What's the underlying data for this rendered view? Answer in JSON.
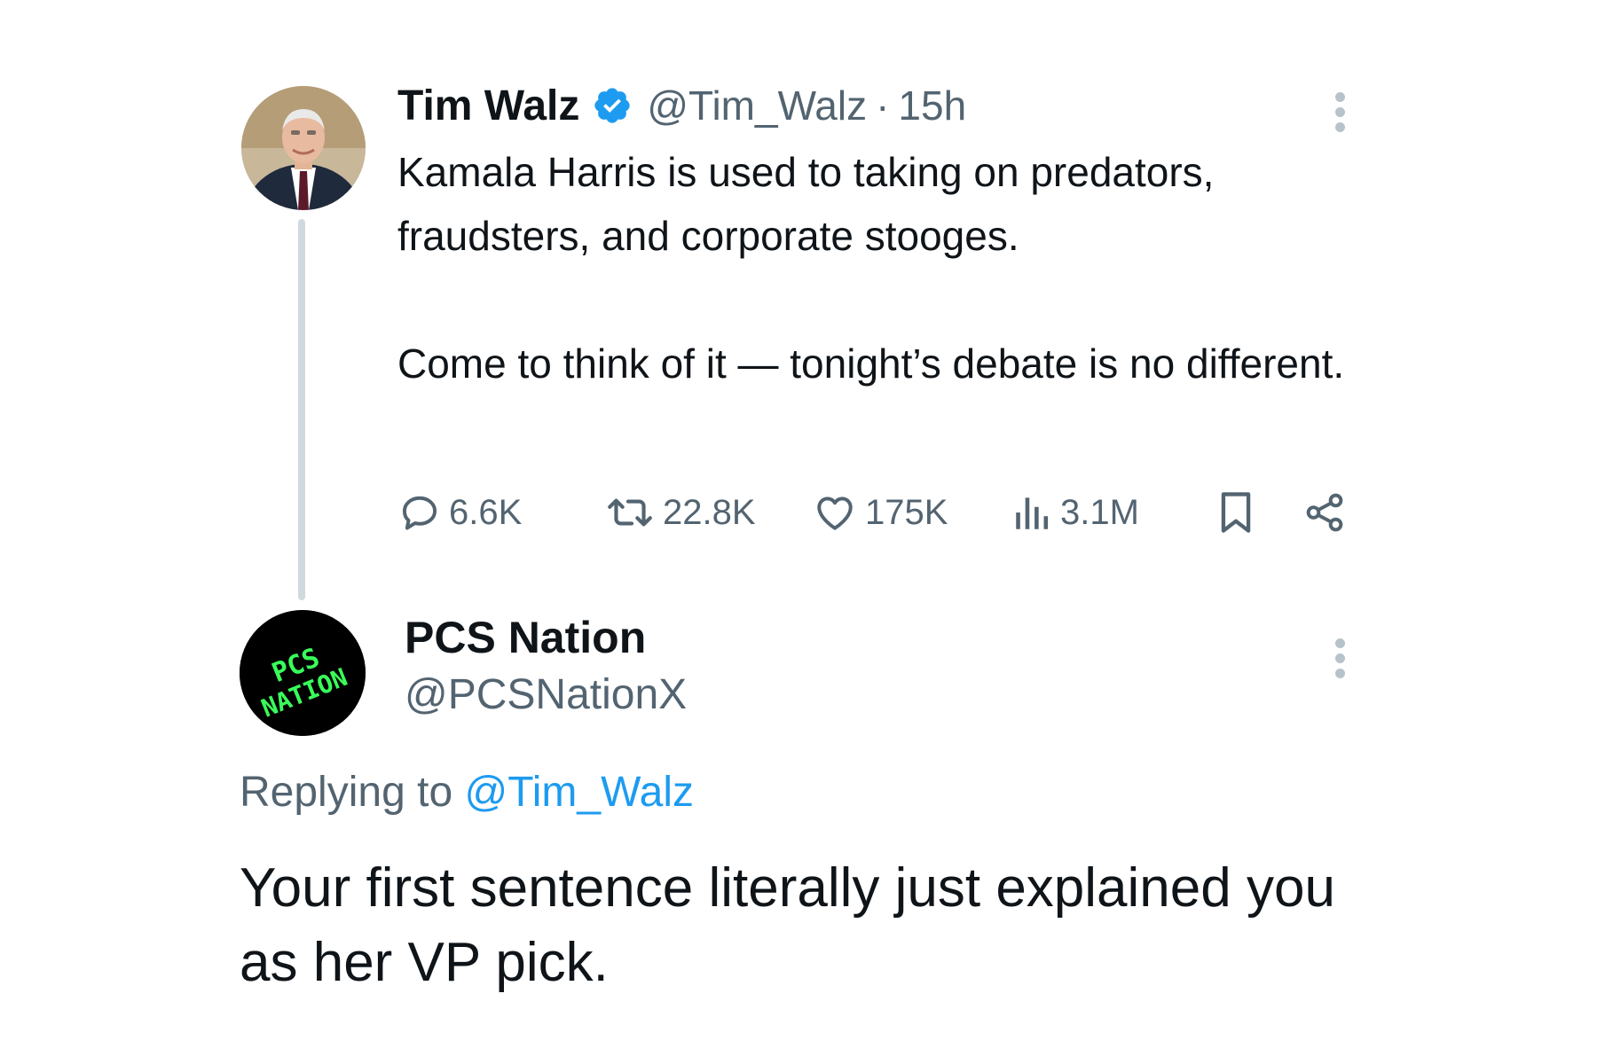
{
  "tweet": {
    "author_name": "Tim Walz",
    "handle": "@Tim_Walz",
    "separator": "·",
    "time": "15h",
    "text_lines": [
      "Kamala Harris is used to taking on predators, fraudsters, and corporate stooges.",
      "Come to think of it — tonight’s debate is no different."
    ],
    "stats": {
      "replies": "6.6K",
      "reposts": "22.8K",
      "likes": "175K",
      "views": "3.1M"
    }
  },
  "reply": {
    "author_name": "PCS Nation",
    "handle": "@PCSNationX",
    "avatar_text": [
      "PCS",
      "NATION"
    ],
    "replying_prefix": "Replying to",
    "replying_to": "@Tim_Walz",
    "text": "Your first sentence literally just explained you as her VP pick."
  },
  "colors": {
    "verified_badge": "#1d9bf0",
    "mention": "#1d9bf0",
    "secondary_text": "#536471",
    "pcs_logo_green": "#39ff5a"
  },
  "icons": {
    "verified": "verified-badge-icon",
    "more": "more-options-icon",
    "reply": "reply-icon",
    "repost": "repost-icon",
    "like": "heart-icon",
    "views": "views-chart-icon",
    "bookmark": "bookmark-icon",
    "share": "share-icon"
  }
}
